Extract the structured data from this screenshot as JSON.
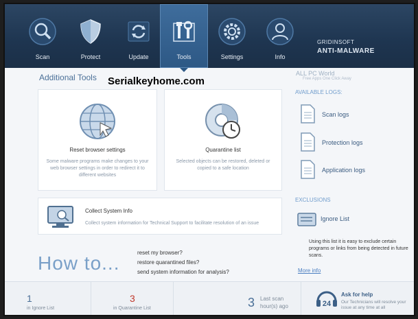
{
  "brand": {
    "small": "GRIDINSOFT",
    "big": "ANTI-MALWARE"
  },
  "nav": [
    {
      "label": "Scan",
      "icon": "magnifier-icon"
    },
    {
      "label": "Protect",
      "icon": "shield-icon"
    },
    {
      "label": "Update",
      "icon": "update-icon"
    },
    {
      "label": "Tools",
      "icon": "tools-icon"
    },
    {
      "label": "Settings",
      "icon": "gear-icon"
    },
    {
      "label": "Info",
      "icon": "person-icon"
    }
  ],
  "main": {
    "title": "Additional Tools",
    "watermark": "Serialkeyhome.com",
    "cards": [
      {
        "title": "Reset browser settings",
        "desc": "Some malware programs make changes to your web browser settings in order to redirect it to different websites"
      },
      {
        "title": "Quarantine list",
        "desc": "Selected objects can be restored, deleted or copied to a safe location"
      }
    ],
    "sysinfo": {
      "title": "Collect System Info",
      "desc": "Collect system information for Technical Support to facilitate resolution of an issue"
    },
    "howto": "How to...",
    "links": [
      "reset my browser?",
      "restore quarantined files?",
      "send system information for analysis?"
    ]
  },
  "right": {
    "allpc": "ALL PC World",
    "allpc_sub": "Free Apps One Click Away",
    "logs_header": "AVAILABLE LOGS:",
    "logs": [
      "Scan logs",
      "Protection logs",
      "Application logs"
    ],
    "excl_header": "EXCLUSIONS",
    "ignore": "Ignore List",
    "excl_desc": "Using this list it is easy to exclude certain programs or links from being detected in future scans.",
    "more": "More info"
  },
  "status": {
    "ignore_count": "1",
    "ignore_label": "in Ignore List",
    "quar_count": "3",
    "quar_label": "in Quarantine List",
    "last_count": "3",
    "last_label1": "Last scan",
    "last_label2": "hour(s) ago",
    "help_title": "Ask for help",
    "help_desc": "Our Technicians will resolve your issue at any time at all",
    "help_badge": "24"
  },
  "colors": {
    "header": "#1e3550",
    "active_tab": "#2d5885",
    "accent": "#4a6f97",
    "quarantine_count": "#c0392b"
  }
}
